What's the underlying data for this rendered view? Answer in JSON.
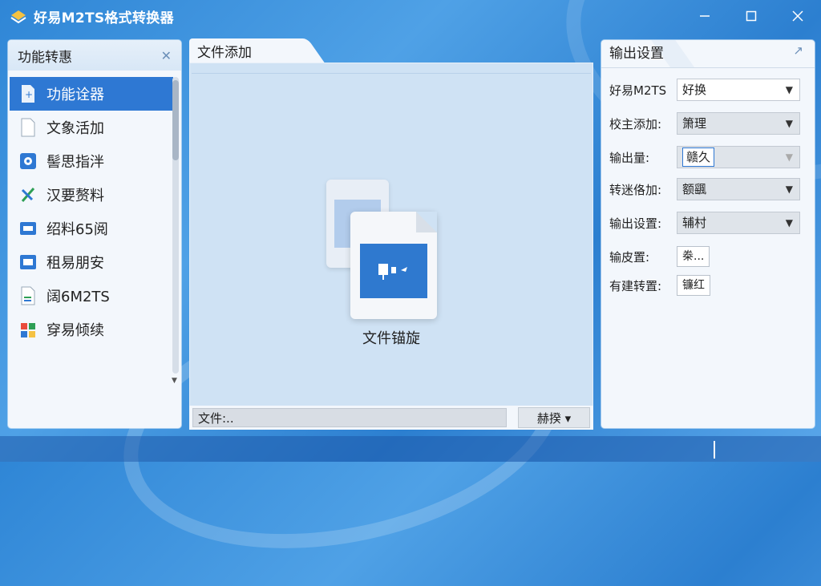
{
  "window": {
    "title": "好易M2TS格式转换器"
  },
  "left_panel": {
    "title": "功能转惠",
    "items": [
      {
        "label": "功能诠器",
        "icon": "add-file-icon"
      },
      {
        "label": "文象活加",
        "icon": "blank-file-icon"
      },
      {
        "label": "髻思指泮",
        "icon": "disc-icon"
      },
      {
        "label": "汉要赘料",
        "icon": "edit-tool-icon"
      },
      {
        "label": "绍料65阅",
        "icon": "video-clip-icon"
      },
      {
        "label": "租易朋安",
        "icon": "monitor-icon"
      },
      {
        "label": "阔6M2TS",
        "icon": "document-icon"
      },
      {
        "label": "穿易倾续",
        "icon": "palette-icon"
      }
    ]
  },
  "center_panel": {
    "tab_label": "文件添加",
    "drop_label": "文件锚旋",
    "file_field": "文件:..",
    "browse_label": "赫揆"
  },
  "right_panel": {
    "tab_label": "输出设置",
    "rows": [
      {
        "label": "好易M2TS",
        "value": "好换"
      },
      {
        "label": "校主添加:",
        "value": "箫理"
      },
      {
        "label": "输出量:",
        "value": "赣久"
      },
      {
        "label": "转迷佫加:",
        "value": "额颻"
      },
      {
        "label": "输出设置:",
        "value": "辅村"
      },
      {
        "label": "输皮置:",
        "value": "桊..."
      },
      {
        "label": "有建转置:",
        "value": "镰红"
      }
    ]
  },
  "colors": {
    "accent": "#2e78d3",
    "background": "#3b8fdb"
  }
}
